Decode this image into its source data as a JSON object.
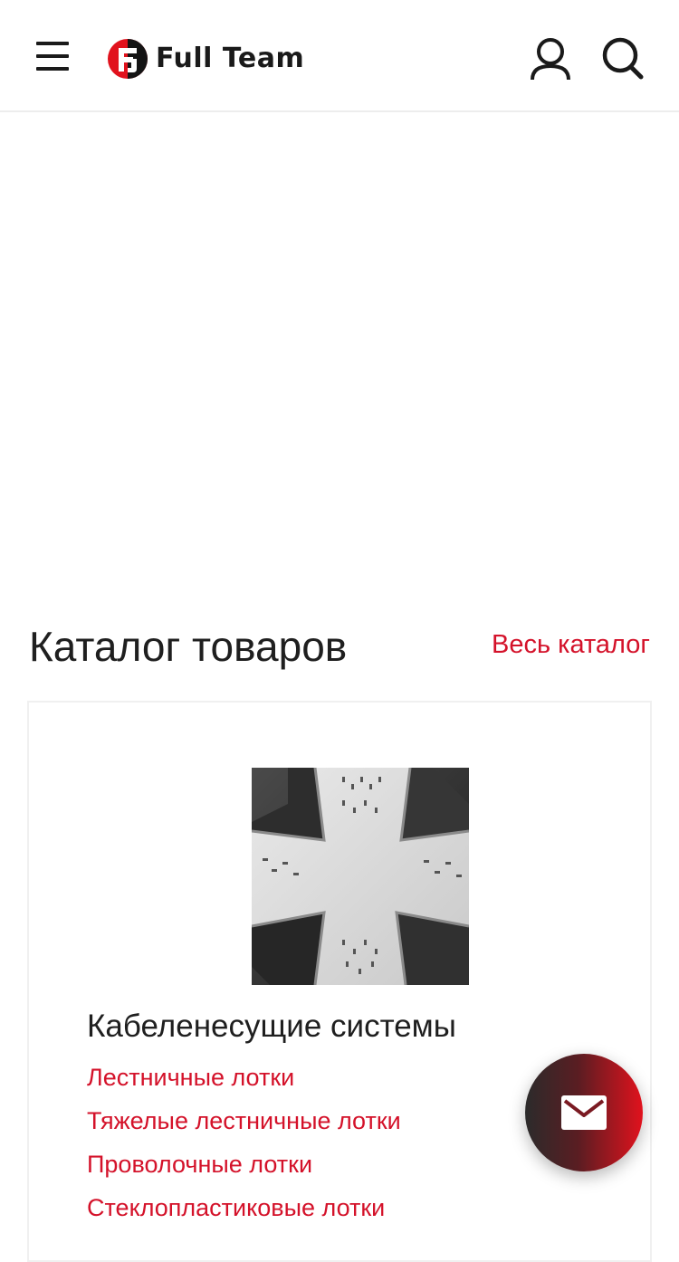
{
  "header": {
    "menu_icon": "hamburger-menu-icon",
    "logo_text": "Full Team",
    "logo_icon": "full-team-logo-mark",
    "user_icon": "user-icon",
    "search_icon": "search-icon"
  },
  "catalog": {
    "title": "Каталог товаров",
    "all_link": "Весь каталог",
    "category": {
      "title": "Кабеленесущие системы",
      "image_icon": "cable-tray-cross-image",
      "links": [
        "Лестничные лотки",
        "Тяжелые лестничные лотки",
        "Проволочные лотки",
        "Стеклопластиковые лотки"
      ]
    }
  },
  "fab": {
    "icon": "mail-icon"
  },
  "colors": {
    "accent": "#d4122a",
    "text": "#1f1f1f",
    "fab_dark": "#2b2b2b",
    "fab_red": "#e1121d"
  }
}
